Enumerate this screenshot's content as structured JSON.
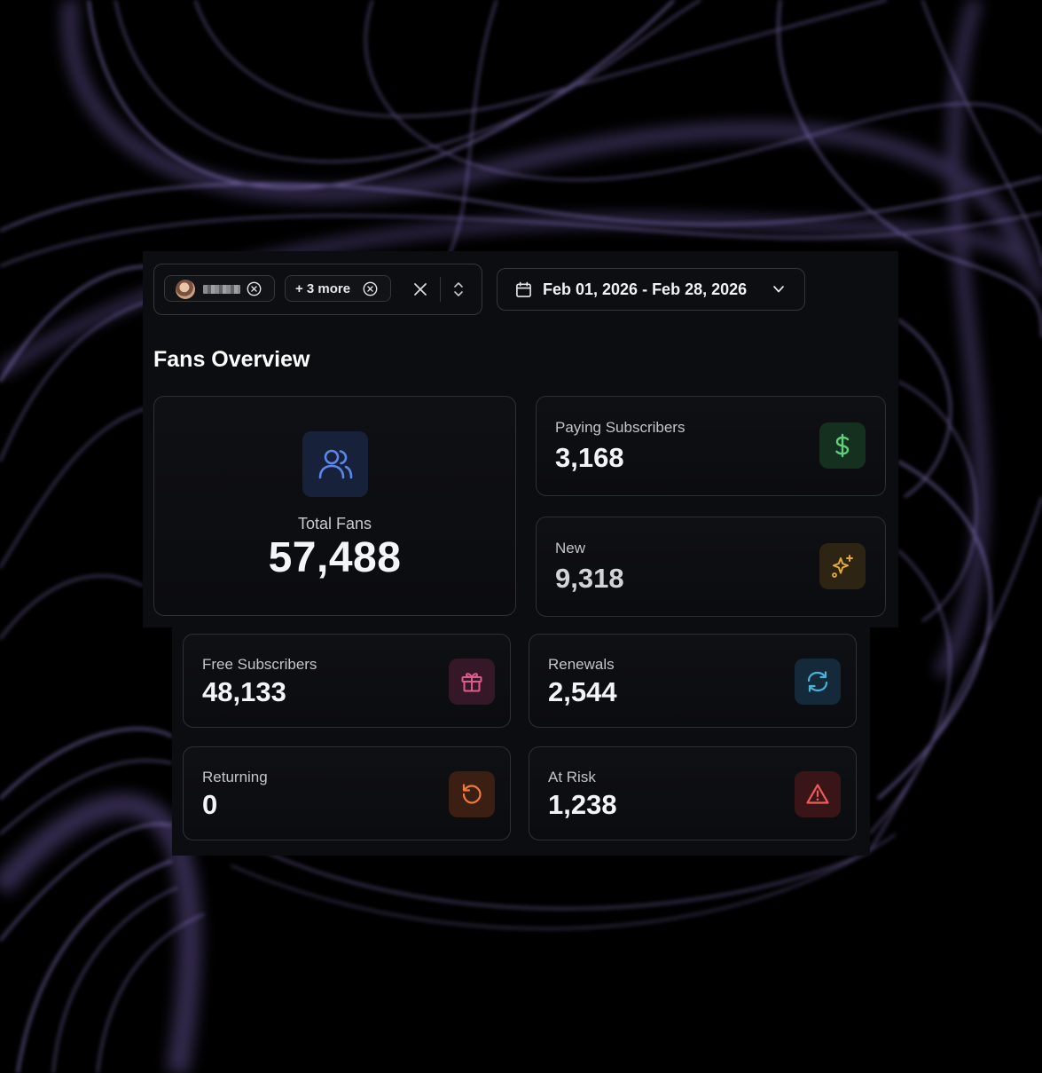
{
  "colors": {
    "background": "#000000",
    "panel": "#0c0d10",
    "border": "#2e3036",
    "accent_purple": "#8f78d8",
    "users_blue": "#5d86e8",
    "dollar_green": "#5fcf7a",
    "sparkle_amber": "#e3a83a",
    "gift_pink": "#e05a8f",
    "refresh_teal": "#4ab1d8",
    "return_orange": "#f07a3a",
    "risk_red": "#ec5a5a"
  },
  "filters": {
    "more_label": "+ 3 more"
  },
  "date_range": {
    "label": "Feb 01, 2026 - Feb 28, 2026"
  },
  "overview": {
    "title": "Fans Overview",
    "total": {
      "label": "Total Fans",
      "value": "57,488",
      "icon": "users-icon"
    },
    "paying": {
      "label": "Paying Subscribers",
      "value": "3,168",
      "icon": "dollar-icon"
    },
    "new": {
      "label": "New",
      "value": "9,318",
      "icon": "sparkles-icon"
    },
    "free": {
      "label": "Free Subscribers",
      "value": "48,133",
      "icon": "gift-icon"
    },
    "renewals": {
      "label": "Renewals",
      "value": "2,544",
      "icon": "refresh-icon"
    },
    "returning": {
      "label": "Returning",
      "value": "0",
      "icon": "rotate-ccw-icon"
    },
    "at_risk": {
      "label": "At Risk",
      "value": "1,238",
      "icon": "alert-triangle-icon"
    }
  }
}
